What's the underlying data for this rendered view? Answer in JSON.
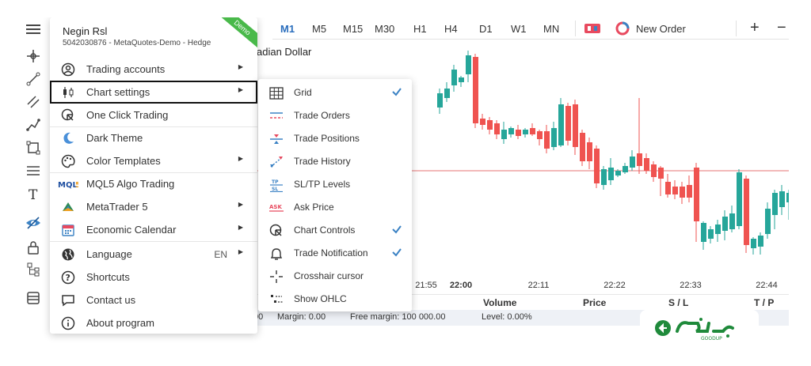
{
  "account": {
    "name": "Negin Rsl",
    "details": "5042030876 - MetaQuotes-Demo - Hedge",
    "badge": "Demo"
  },
  "menu": {
    "items": [
      {
        "label": "Trading accounts",
        "icon": "user-circle-icon",
        "has_submenu": true
      },
      {
        "label": "Chart settings",
        "icon": "candlestick-icon",
        "has_submenu": true,
        "selected": true
      },
      {
        "label": "One Click Trading",
        "icon": "cursor-click-icon",
        "has_submenu": false
      },
      {
        "label": "Dark Theme",
        "icon": "moon-icon",
        "has_submenu": false
      },
      {
        "label": "Color Templates",
        "icon": "palette-icon",
        "has_submenu": true
      },
      {
        "label": "MQL5 Algo Trading",
        "icon": "mql5-logo",
        "has_submenu": false
      },
      {
        "label": "MetaTrader 5",
        "icon": "metatrader-logo",
        "has_submenu": true
      },
      {
        "label": "Economic Calendar",
        "icon": "calendar-icon",
        "has_submenu": true
      },
      {
        "label": "Language",
        "icon": "globe-icon",
        "has_submenu": true,
        "value": "EN"
      },
      {
        "label": "Shortcuts",
        "icon": "question-circle-icon",
        "has_submenu": false
      },
      {
        "label": "Contact us",
        "icon": "chat-icon",
        "has_submenu": false
      },
      {
        "label": "About program",
        "icon": "info-circle-icon",
        "has_submenu": false
      }
    ]
  },
  "submenu": {
    "items": [
      {
        "label": "Grid",
        "icon": "grid-icon",
        "checked": true
      },
      {
        "label": "Trade Orders",
        "icon": "trade-orders-icon",
        "checked": false
      },
      {
        "label": "Trade Positions",
        "icon": "trade-positions-icon",
        "checked": false
      },
      {
        "label": "Trade History",
        "icon": "trade-history-icon",
        "checked": false
      },
      {
        "label": "SL/TP Levels",
        "icon": "sltp-levels-icon",
        "checked": false
      },
      {
        "label": "Ask Price",
        "icon": "ask-price-icon",
        "checked": false
      },
      {
        "label": "Chart Controls",
        "icon": "chart-controls-icon",
        "checked": true
      },
      {
        "label": "Trade Notification",
        "icon": "bell-icon",
        "checked": true
      },
      {
        "label": "Crosshair cursor",
        "icon": "crosshair-icon",
        "checked": false
      },
      {
        "label": "Show OHLC",
        "icon": "ohlc-icon",
        "checked": false
      }
    ],
    "sltp_icon_text": [
      "TP",
      "SL"
    ],
    "ask_icon_text": "ASK"
  },
  "timeframes": [
    "M1",
    "M5",
    "M15",
    "M30",
    "H1",
    "H4",
    "D1",
    "W1",
    "MN"
  ],
  "active_timeframe": "M1",
  "toolbar_actions": {
    "new_order": "New Order",
    "add": "+",
    "remove": "−"
  },
  "chart": {
    "title_fragment": "adian Dollar",
    "time_labels": [
      "21:55",
      "22:00",
      "22:11",
      "22:22",
      "22:33",
      "22:44"
    ],
    "bold_time_label": "22:00",
    "bull_color": "#26a69a",
    "bear_color": "#ef5350",
    "price_line_color": "#e57373"
  },
  "trade_columns": [
    "Volume",
    "Price",
    "S / L",
    "T / P"
  ],
  "status": {
    "fragment": "00",
    "margin": "Margin: 0.00",
    "free_margin": "Free margin: 100 000.00",
    "level": "Level: 0.00%"
  },
  "watermark": {
    "text": "GOODUP"
  }
}
